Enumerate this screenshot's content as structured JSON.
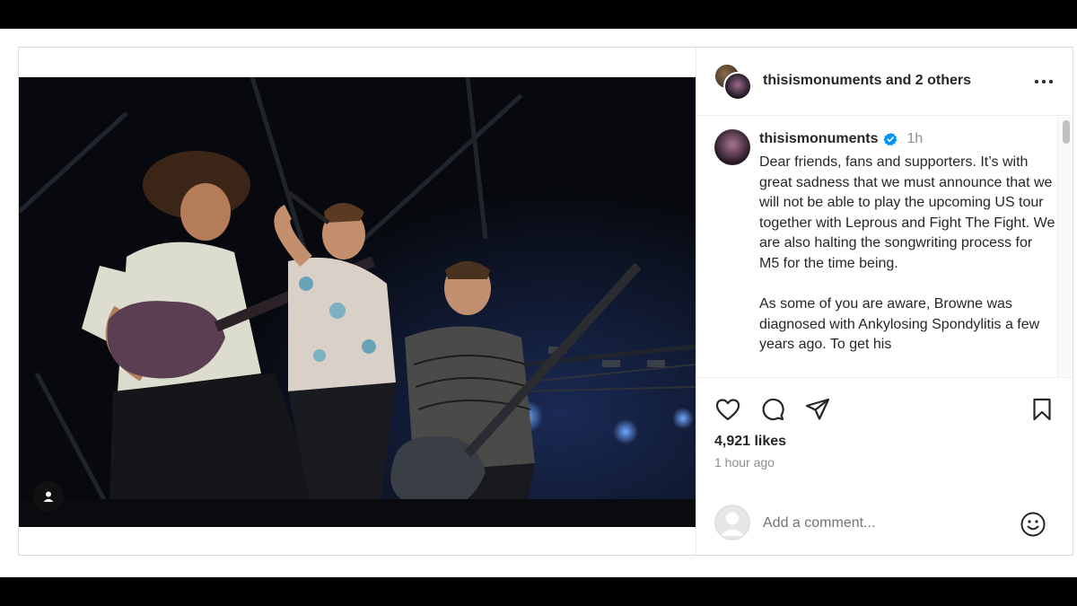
{
  "post": {
    "header": {
      "username": "thisismonuments",
      "collab_suffix": " and 2 others",
      "more_icon": "more-horizontal-icon"
    },
    "caption": {
      "username": "thisismonuments",
      "verified_icon": "verified-badge-icon",
      "time": "1h",
      "text": "Dear friends, fans and supporters. It’s with great sadness that we must announce that we will not be able to play the upcoming US tour together with Leprous and Fight The Fight. We are also halting the songwriting process for M5 for the time being.\n\nAs some of you are aware, Browne was diagnosed with Ankylosing Spondylitis a few years ago. To get his"
    },
    "actions": {
      "like_icon": "heart-icon",
      "comment_icon": "comment-icon",
      "share_icon": "send-icon",
      "save_icon": "bookmark-icon"
    },
    "likes": "4,921 likes",
    "time_ago": "1 hour ago",
    "comment_box": {
      "placeholder": "Add a comment...",
      "emoji_icon": "emoji-icon"
    },
    "media": {
      "tag_icon": "user-tag-icon"
    },
    "colors": {
      "verified": "#0095f6",
      "text": "#262626",
      "secondary": "#8e8e8e"
    }
  }
}
